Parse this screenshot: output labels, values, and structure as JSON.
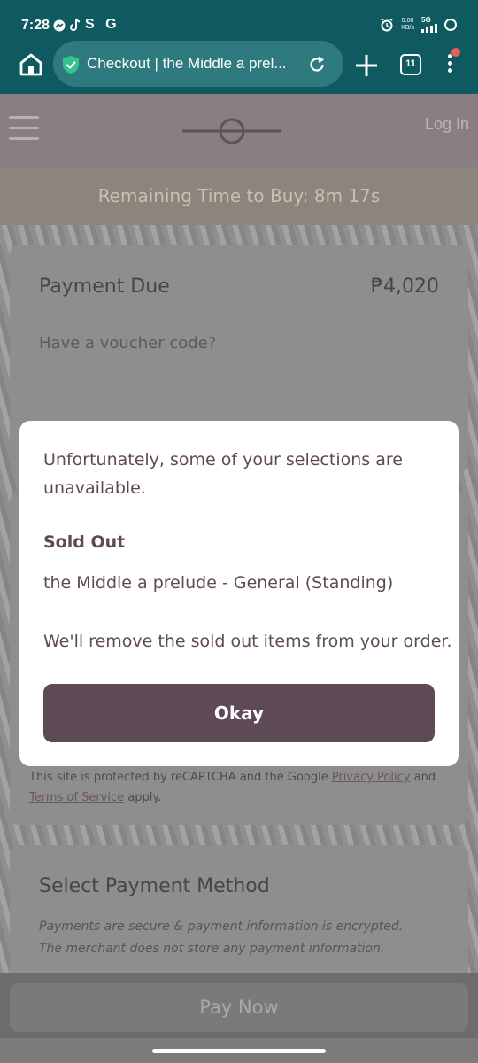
{
  "status_bar": {
    "time": "7:28",
    "app_icons": "S G",
    "net_speed": "0.00",
    "net_unit": "KB/s",
    "network": "5G"
  },
  "browser": {
    "url_title": "Checkout | the Middle a prel...",
    "tab_count": "11"
  },
  "site": {
    "login_label": "Log In",
    "timer_text": "Remaining Time to Buy: 8m 17s"
  },
  "payment": {
    "due_label": "Payment Due",
    "amount": "₱4,020",
    "voucher_prompt": "Have a voucher code?"
  },
  "recaptcha": {
    "prefix": "This site is protected by reCAPTCHA and the Google",
    "privacy_link": "Privacy Policy",
    "and": "and",
    "terms_link": "Terms of Service",
    "suffix": "apply."
  },
  "payment_method": {
    "title": "Select Payment Method",
    "note": "Payments are secure & payment information is encrypted. The merchant does not store any payment information."
  },
  "footer": {
    "pay_now_label": "Pay Now"
  },
  "modal": {
    "message": "Unfortunately, some of your selections are unavailable.",
    "sold_out_title": "Sold Out",
    "item": "the Middle a prelude - General (Standing)",
    "note": "We'll remove the sold out items from your order.",
    "okay_label": "Okay"
  },
  "colors": {
    "browser_teal": "#0e5a60",
    "brand_plum": "#5e4a57",
    "notification_red": "#e85d5d"
  }
}
